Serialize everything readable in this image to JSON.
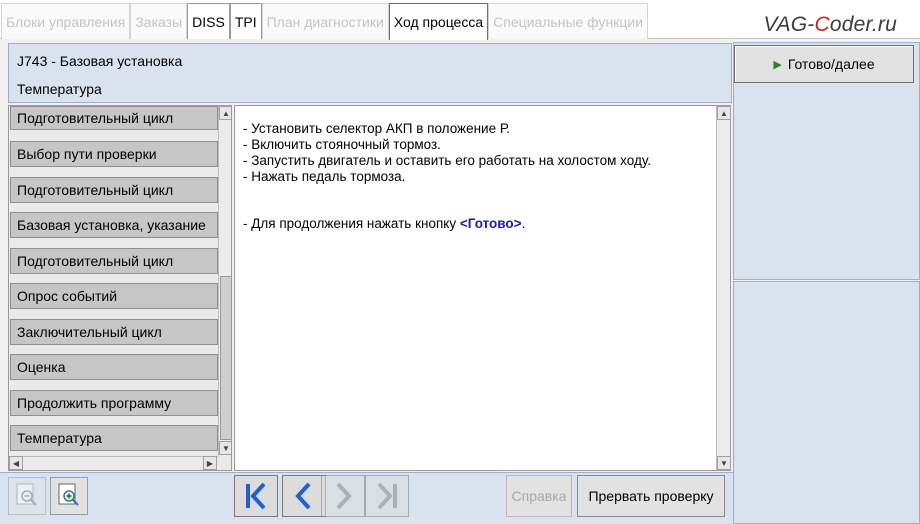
{
  "tabs": [
    {
      "label": "Блоки управления",
      "state": "disabled"
    },
    {
      "label": "Заказы",
      "state": "disabled"
    },
    {
      "label": "DISS",
      "state": "enabled"
    },
    {
      "label": "TPI",
      "state": "enabled"
    },
    {
      "label": "План диагностики",
      "state": "disabled"
    },
    {
      "label": "Ход процесса",
      "state": "active"
    },
    {
      "label": "Специальные функции",
      "state": "disabled"
    }
  ],
  "logo": {
    "pre": "VAG-",
    "accent": "C",
    "post": "oder.ru"
  },
  "header": {
    "line1": "J743 - Базовая установка",
    "line2": "Температура"
  },
  "ready_button": "Готово/далее",
  "steps": [
    "Подготовительный цикл",
    "Выбор пути проверки",
    "Подготовительный цикл",
    "Базовая установка, указание",
    "Подготовительный цикл",
    "Опрос событий",
    "Заключительный цикл",
    "Оценка",
    "Продолжить программу",
    "Температура"
  ],
  "instructions": [
    "- Установить селектор АКП в положение Р.",
    "- Включить стояночный тормоз.",
    "- Запустить двигатель и оставить его работать на холостом ходу.",
    "- Нажать педаль тормоза."
  ],
  "continue_text": {
    "prefix": "- Для продолжения нажать кнопку ",
    "button": "<Готово>",
    "suffix": "."
  },
  "buttons": {
    "help": "Справка",
    "abort": "Прервать проверку"
  },
  "icons": {
    "zoom_out": "zoom-out-icon",
    "zoom_in": "zoom-in-icon",
    "first": "skip-to-first-icon",
    "prev": "chevron-left-icon",
    "next": "chevron-right-icon",
    "last": "skip-to-last-icon",
    "play": "play-icon"
  },
  "colors": {
    "panel": "#d9e3ef",
    "nav_blue": "#1f5fd0",
    "highlight_text": "#1a1ab4",
    "play_green": "#1f8a1f"
  }
}
